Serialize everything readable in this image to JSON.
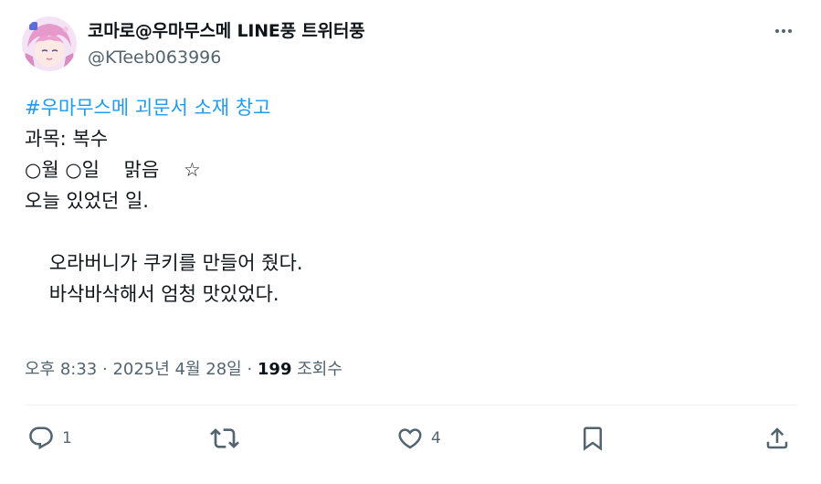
{
  "author": {
    "display_name": "코마로@우마무스메 LINE풍 트위터풍",
    "handle": "@KTeeb063996"
  },
  "tweet": {
    "hashtag": "#우마무스메 괴문서 소재 창고",
    "lines": [
      "과목: 복수",
      "○월 ○일    맑음    ☆",
      "오늘 있었던 일.",
      "",
      "    오라버니가 쿠키를 만들어 줬다.",
      "    바삭바삭해서 엄청 맛있었다."
    ]
  },
  "meta": {
    "time": "오후 8:33",
    "separator1": " · ",
    "date": "2025년 4월 28일",
    "separator2": " · ",
    "views_count": "199",
    "views_label": " 조회수"
  },
  "actions": {
    "reply_count": "1",
    "repost_count": "",
    "like_count": "4"
  },
  "icons": {
    "more": "more-horizontal-icon",
    "reply": "reply-icon",
    "repost": "repost-icon",
    "like": "heart-icon",
    "bookmark": "bookmark-icon",
    "share": "share-icon"
  },
  "colors": {
    "hashtag": "#1d9bf0",
    "secondary_text": "#536471",
    "primary_text": "#0f1419",
    "divider": "#eff3f4"
  }
}
